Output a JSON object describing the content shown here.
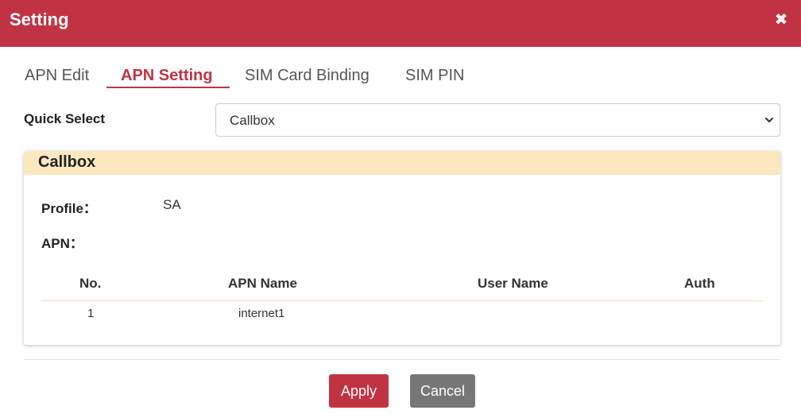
{
  "dialog": {
    "title": "Setting",
    "close_symbol": "✖"
  },
  "tabs": [
    {
      "label": "APN Edit",
      "active": false
    },
    {
      "label": "APN Setting",
      "active": true
    },
    {
      "label": "SIM Card Binding",
      "active": false
    },
    {
      "label": "SIM PIN",
      "active": false
    }
  ],
  "quick_select": {
    "label": "Quick Select",
    "value": "Callbox"
  },
  "profile_card": {
    "title": "Callbox",
    "profile_label": "Profile：",
    "profile_value": "SA",
    "apn_label": "APN：",
    "table": {
      "headers": [
        "No.",
        "APN Name",
        "User Name",
        "Auth"
      ],
      "rows": [
        [
          "1",
          "internet1",
          "",
          ""
        ]
      ]
    }
  },
  "buttons": {
    "apply": "Apply",
    "cancel": "Cancel"
  },
  "colors": {
    "brand": "#c13343",
    "card_header": "#fbe8bf",
    "cancel": "#777777"
  },
  "icons": {
    "close": "close-icon",
    "select_caret": "chevron-down-icon"
  }
}
